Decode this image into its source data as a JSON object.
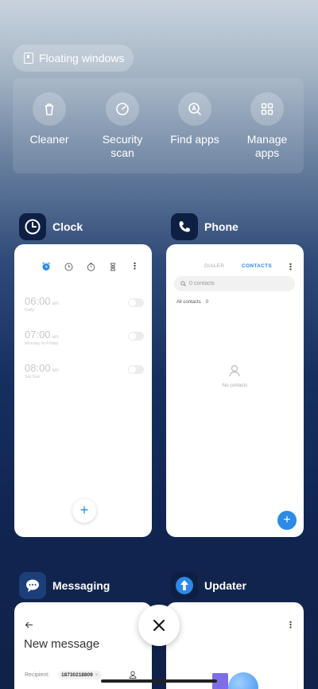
{
  "floating_chip": {
    "label": "Floating windows",
    "icon": "floating-window-icon"
  },
  "tools": [
    {
      "label": "Cleaner",
      "icon": "trash-icon"
    },
    {
      "label": "Security scan",
      "icon": "security-icon"
    },
    {
      "label": "Find apps",
      "icon": "find-apps-icon"
    },
    {
      "label": "Manage apps",
      "icon": "grid-icon"
    }
  ],
  "clock": {
    "name": "Clock",
    "alarms": [
      {
        "time": "06:00",
        "ampm": "am",
        "sub": "Daily"
      },
      {
        "time": "07:00",
        "ampm": "am",
        "sub": "Monday to Friday"
      },
      {
        "time": "08:00",
        "ampm": "am",
        "sub": "Sat Sun"
      }
    ],
    "fab": "+"
  },
  "phone": {
    "name": "Phone",
    "tab_dialer": "DIALER",
    "tab_contacts": "CONTACTS",
    "search_placeholder": "0 contacts",
    "group_label": "All contacts",
    "group_count": "0",
    "empty_label": "No contacts",
    "fab": "+"
  },
  "messaging": {
    "name": "Messaging",
    "title": "New message",
    "recipient_label": "Recipient:",
    "recipient_value": "18730218809"
  },
  "updater": {
    "name": "Updater"
  },
  "colors": {
    "accent": "#2b8be6",
    "messaging_icon": "#1c3f7a",
    "updater_icon": "#2d89e5"
  }
}
